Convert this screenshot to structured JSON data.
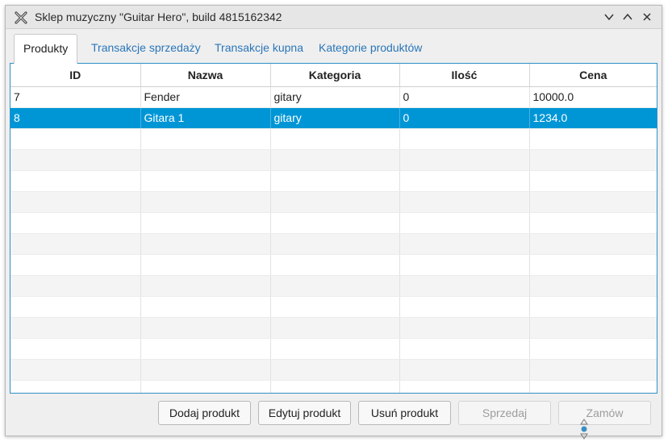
{
  "window": {
    "title": "Sklep muzyczny \"Guitar Hero\", build 4815162342",
    "icons": {
      "app": "x-logo-icon",
      "minimize": "chevron-down-icon",
      "maximize": "chevron-up-icon",
      "close": "close-icon"
    }
  },
  "tabs": [
    {
      "label": "Produkty",
      "active": true
    },
    {
      "label": "Transakcje sprzedaży",
      "active": false
    },
    {
      "label": "Transakcje kupna",
      "active": false
    },
    {
      "label": "Kategorie produktów",
      "active": false
    }
  ],
  "table": {
    "columns": [
      "ID",
      "Nazwa",
      "Kategoria",
      "Ilość",
      "Cena"
    ],
    "rows": [
      {
        "id": "7",
        "nazwa": "Fender",
        "kategoria": "gitary",
        "ilosc": "0",
        "cena": "10000.0",
        "selected": false
      },
      {
        "id": "8",
        "nazwa": "Gitara 1",
        "kategoria": "gitary",
        "ilosc": "0",
        "cena": "1234.0",
        "selected": true
      }
    ]
  },
  "buttons": {
    "add": "Dodaj produkt",
    "edit": "Edytuj produkt",
    "delete": "Usuń produkt",
    "sell": "Sprzedaj",
    "order": "Zamów"
  },
  "colors": {
    "selection": "#0096d6",
    "accent_border": "#2d91c9",
    "tab_link": "#2a76b8"
  }
}
